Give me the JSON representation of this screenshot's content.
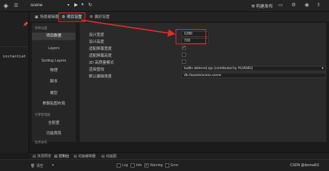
{
  "topbar": {
    "logo_icon": "cocos-logo-icon",
    "menu_icon": "hamburger-icon",
    "scene": "scene",
    "publish_label": "构建发布",
    "right_icons": [
      "layout-icon",
      "settings-icon",
      "user-icon",
      "share-icon"
    ]
  },
  "left_panel": {
    "row_text": "instantiat"
  },
  "tabs": [
    {
      "label": "场景编辑器",
      "icon": "scene-editor-icon"
    },
    {
      "label": "项目设置",
      "icon": "gear-icon"
    },
    {
      "label": "偏好设置",
      "icon": "preferences-icon"
    }
  ],
  "settings_sidebar": {
    "group1": "项目设置",
    "items1": [
      "项目数据",
      "Layers",
      "Sorting Layers",
      "物理",
      "脚本",
      "模型",
      "骨骼贴图布局"
    ],
    "group2": "引擎管理器",
    "items2": [
      "功能裁剪"
    ],
    "group3": "程序发布",
    "partial1": "全配置"
  },
  "settings_main": {
    "labels": [
      "设计宽度",
      "设计高度",
      "适配屏幕宽度",
      "适配屏幕高度",
      "3D 高质量模式",
      "渲染管线",
      "默认编辑场景"
    ],
    "design_width": "1280",
    "design_height": "720",
    "fit_width_checked": true,
    "fit_height_checked": false,
    "hq_3d_checked": false,
    "pipeline": "builtin-deferred.rpp (contributed by HUAWEI)",
    "default_scene": "db://assets/scene.scene"
  },
  "bottom_tabs": [
    {
      "label": "资源预览",
      "icon": "preview-icon"
    },
    {
      "label": "控制台",
      "icon": "console-icon"
    },
    {
      "label": "动画编辑器",
      "icon": "animation-icon"
    },
    {
      "label": "动画图",
      "icon": "anim-graph-icon"
    }
  ],
  "bottom_bar": {
    "clear": "清空",
    "log": "Log",
    "info": "Info",
    "warning": "Warning",
    "error": "Error",
    "log_checked": false,
    "info_checked": false,
    "warning_checked": true,
    "error_checked": false
  },
  "watermark": "CSDN @dermal53",
  "colors": {
    "accent_red": "#e32b2b",
    "panel_bg": "#2a2a2a"
  }
}
